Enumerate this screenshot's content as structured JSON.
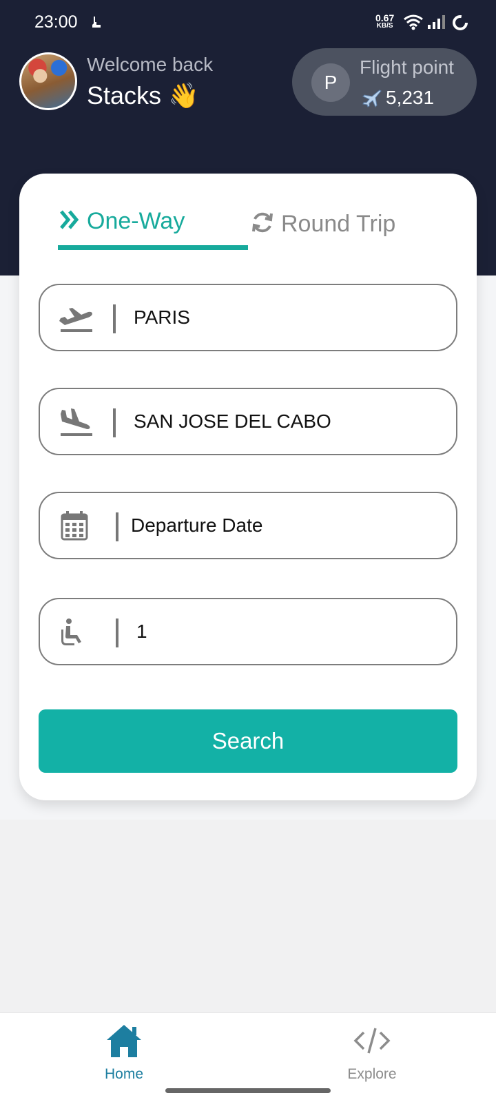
{
  "status_bar": {
    "time": "23:00",
    "net_speed_value": "0.67",
    "net_speed_unit": "KB/S",
    "icons": [
      "message-icon",
      "wifi-icon",
      "signal-icon",
      "battery-icon"
    ]
  },
  "header": {
    "welcome_text": "Welcome back",
    "username": "Stacks 👋",
    "points": {
      "avatar_letter": "P",
      "label": "Flight point",
      "value": "5,231"
    }
  },
  "tabs": [
    {
      "label": "One-Way",
      "active": true,
      "icon": "double-chevron-right-icon"
    },
    {
      "label": "Round Trip",
      "active": false,
      "icon": "refresh-icon"
    }
  ],
  "form": {
    "origin": "PARIS",
    "destination": "SAN JOSE DEL CABO",
    "departure_date_placeholder": "Departure Date",
    "passengers": "1",
    "search_label": "Search"
  },
  "bottom_nav": [
    {
      "label": "Home",
      "icon": "home-icon",
      "active": true
    },
    {
      "label": "Explore",
      "icon": "code-icon",
      "active": false
    }
  ],
  "colors": {
    "header_bg": "#1b2035",
    "accent": "#13b1a6",
    "nav_active": "#1d7ea0"
  }
}
